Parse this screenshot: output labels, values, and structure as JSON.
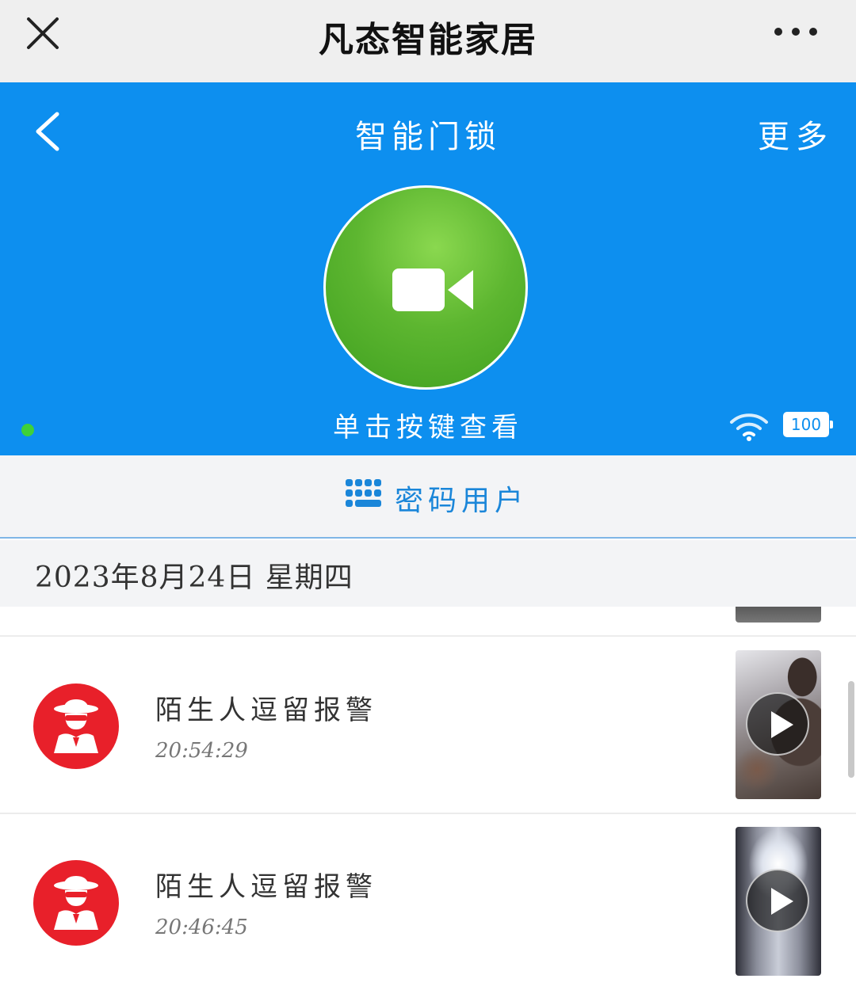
{
  "app": {
    "title": "凡态智能家居",
    "close_icon": "close-icon",
    "menu_icon": "more-dots-icon"
  },
  "header": {
    "title": "智能门锁",
    "more_label": "更多",
    "back_icon": "back-arrow-icon",
    "camera_icon": "video-camera-icon",
    "hint": "单击按键查看",
    "status_dot_color": "#3ed13a",
    "wifi_icon": "wifi-icon",
    "battery_level": "100",
    "accent_color": "#0d8fef",
    "button_color": "#5db630"
  },
  "password_users": {
    "label": "密码用户",
    "icon": "keypad-icon"
  },
  "date_header": "2023年8月24日  星期四",
  "records": [
    {
      "title": "陌生人逗留报警",
      "time": "20:54:29",
      "icon": "stranger-icon",
      "play_icon": "play-icon"
    },
    {
      "title": "陌生人逗留报警",
      "time": "20:46:45",
      "icon": "stranger-icon",
      "play_icon": "play-icon"
    }
  ],
  "alert_color": "#e8202a"
}
